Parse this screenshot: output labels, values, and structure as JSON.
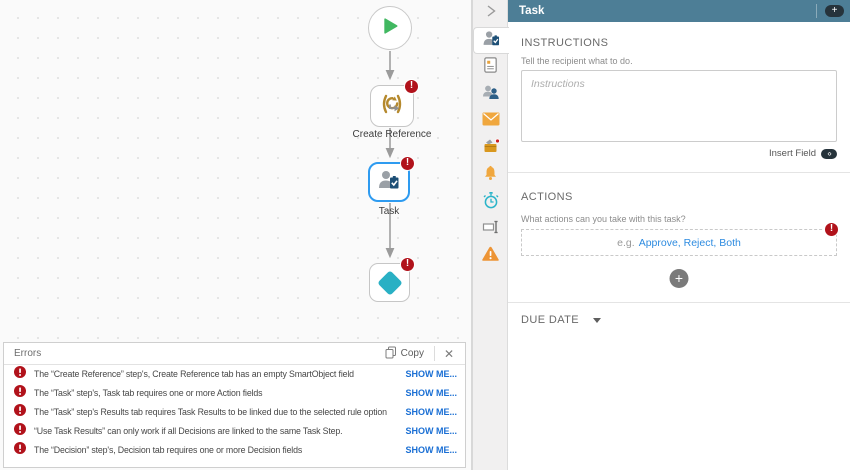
{
  "canvas": {
    "nodes": [
      {
        "id": "start",
        "label": ""
      },
      {
        "id": "create-reference",
        "label": "Create Reference",
        "has_error": true
      },
      {
        "id": "task",
        "label": "Task",
        "has_error": true,
        "selected": true
      },
      {
        "id": "decision",
        "label": "",
        "has_error": true
      }
    ],
    "error_badge_glyph": "!"
  },
  "errors_panel": {
    "title": "Errors",
    "copy_label": "Copy",
    "close_glyph": "✕",
    "errors": [
      {
        "text": "The “Create Reference” step's, Create Reference tab has an empty SmartObject field",
        "link": "SHOW ME..."
      },
      {
        "text": "The “Task” step's, Task tab requires one or more Action fields",
        "link": "SHOW ME..."
      },
      {
        "text": "The “Task” step's Results tab requires Task Results to be linked due to the selected rule option",
        "link": "SHOW ME..."
      },
      {
        "text": "“Use Task Results” can only work if all Decisions are linked to the same Task Step.",
        "link": "SHOW ME..."
      },
      {
        "text": "The “Decision” step's, Decision tab requires one or more Decision fields",
        "link": "SHOW ME..."
      }
    ]
  },
  "panel": {
    "title": "Task",
    "header_toggle_glyph": "+",
    "tabs": [
      {
        "name": "task",
        "selected": true
      },
      {
        "name": "form",
        "selected": false
      },
      {
        "name": "recipients",
        "selected": false
      },
      {
        "name": "notifications",
        "selected": false
      },
      {
        "name": "results",
        "selected": false
      },
      {
        "name": "reminders",
        "selected": false
      },
      {
        "name": "timing",
        "selected": false
      },
      {
        "name": "rename",
        "selected": false
      },
      {
        "name": "errors",
        "selected": false
      }
    ],
    "instructions": {
      "heading": "INSTRUCTIONS",
      "subtext": "Tell the recipient what to do.",
      "placeholder": "Instructions",
      "value": "",
      "insert_field_label": "Insert Field",
      "insert_field_glyph": "‹›"
    },
    "actions": {
      "heading": "ACTIONS",
      "subtext": "What actions can you take with this task?",
      "example_prefix": "e.g.",
      "example_links": "Approve, Reject, Both"
    },
    "due_date": {
      "heading": "DUE DATE"
    }
  },
  "icons": {
    "start-icon": "green play triangle",
    "reference-icon": "gold brackets with arrow",
    "task-step-icon": "person with clipboard",
    "decision-icon": "teal diamond",
    "error-icon": "red circle exclamation",
    "copy-icon": "two overlapping pages",
    "collapse-icon": "chevron right"
  },
  "colors": {
    "header_teal": "#4d7e96",
    "error_red": "#b1121b",
    "link_blue": "#1a6fd4",
    "selection_blue": "#2e9bf0",
    "start_green": "#41b861",
    "decision_teal": "#29b0c4",
    "amber": "#f0a73e",
    "reference_gold": "#b5892d"
  }
}
